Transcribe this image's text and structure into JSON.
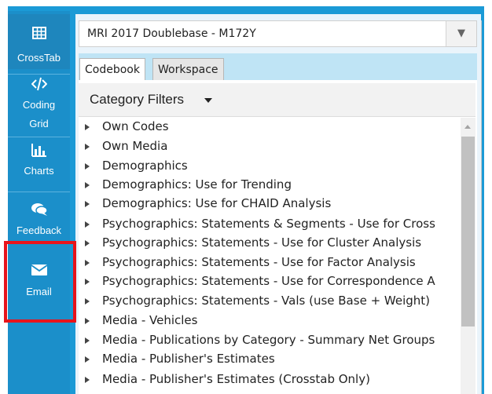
{
  "sidebar": {
    "items": [
      {
        "label": "CrossTab",
        "icon": "table-icon"
      },
      {
        "label": "Coding Grid",
        "line1": "Coding",
        "line2": "Grid",
        "icon": "code-icon"
      },
      {
        "label": "Charts",
        "icon": "bar-chart-icon"
      },
      {
        "label": "Feedback",
        "icon": "chat-icon"
      },
      {
        "label": "Email",
        "icon": "envelope-icon"
      }
    ]
  },
  "dataset": {
    "value": "MRI 2017 Doublebase - M172Y"
  },
  "tabs": [
    {
      "label": "Codebook",
      "active": true
    },
    {
      "label": "Workspace",
      "active": false
    }
  ],
  "category_filters": {
    "label": "Category Filters"
  },
  "tree": {
    "items": [
      "Own Codes",
      "Own Media",
      "Demographics",
      "Demographics: Use for Trending",
      "Demographics: Use for CHAID Analysis",
      "Psychographics: Statements & Segments - Use for Cross",
      "Psychographics: Statements - Use for Cluster Analysis",
      "Psychographics: Statements - Use for Factor Analysis",
      "Psychographics: Statements - Use for Correspondence A",
      "Psychographics: Statements - Vals (use Base + Weight)",
      "Media - Vehicles",
      "Media - Publications by Category - Summary Net Groups",
      "Media - Publisher's Estimates",
      "Media - Publisher's Estimates (Crosstab Only)"
    ]
  },
  "colors": {
    "sidebar": "#1b8fca",
    "accent": "#1b9ad6",
    "highlight": "#e8141b"
  }
}
